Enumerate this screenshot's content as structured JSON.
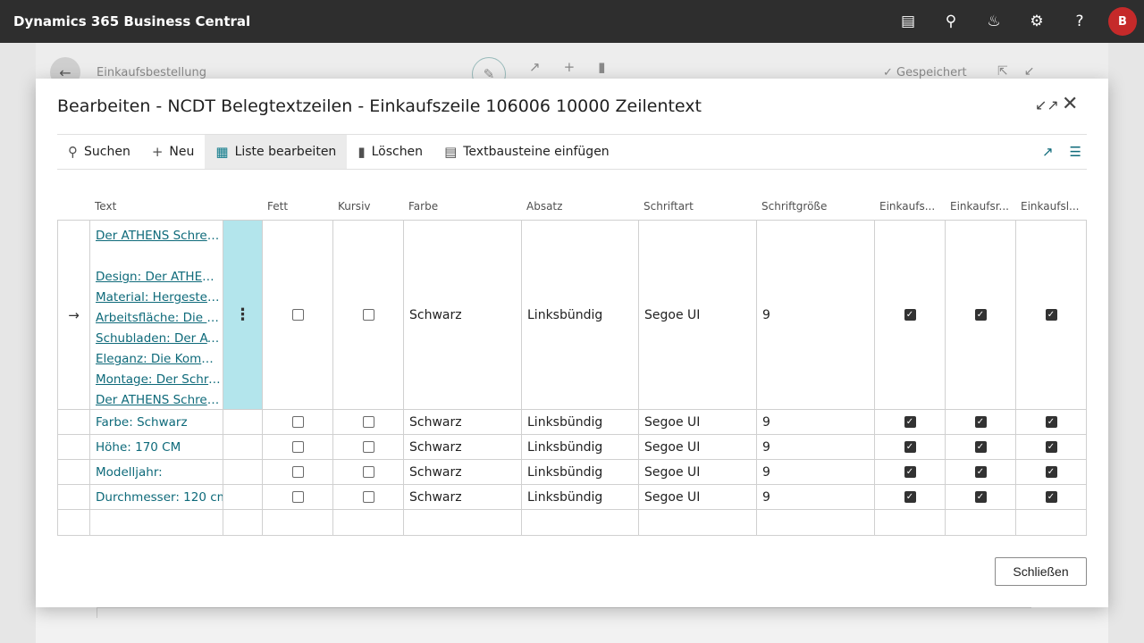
{
  "appbar": {
    "title": "Dynamics 365 Business Central",
    "avatar_initial": "B",
    "icons": [
      "document-icon",
      "search-icon",
      "bell-icon",
      "gear-icon",
      "help-icon"
    ]
  },
  "background_page": {
    "title": "Einkaufsbestellung",
    "saved_label": "Gespeichert"
  },
  "dialog": {
    "title": "Bearbeiten - NCDT Belegtextzeilen - Einkaufszeile 106006 10000 Zeilentext",
    "actions": {
      "search": "Suchen",
      "new": "Neu",
      "edit_list": "Liste bearbeiten",
      "delete": "Löschen",
      "insert_text_blocks": "Textbausteine einfügen"
    },
    "columns": {
      "text": "Text",
      "bold": "Fett",
      "italic": "Kursiv",
      "color": "Farbe",
      "paragraph": "Absatz",
      "font": "Schriftart",
      "font_size": "Schriftgröße",
      "purchase1": "Einkaufs...",
      "purchase2": "Einkaufsr...",
      "purchase3": "Einkaufsl..."
    },
    "rows": [
      {
        "lines": [
          "Der ATHENS Schreib...",
          "",
          "Design: Der ATHENS ...",
          "Material: Hergestellt ...",
          "Arbeitsfläche: Die gr...",
          "Schubladen: Der ATH...",
          "Eleganz: Die Kombin...",
          "Montage: Der Schrei...",
          "Der ATHENS Schreib..."
        ],
        "color": "Schwarz",
        "paragraph": "Linksbündig",
        "font": "Segoe UI",
        "font_size": "9"
      },
      {
        "text": "Farbe: Schwarz",
        "color": "Schwarz",
        "paragraph": "Linksbündig",
        "font": "Segoe UI",
        "font_size": "9"
      },
      {
        "text": "Höhe: 170 CM",
        "color": "Schwarz",
        "paragraph": "Linksbündig",
        "font": "Segoe UI",
        "font_size": "9"
      },
      {
        "text": "Modelljahr:",
        "color": "Schwarz",
        "paragraph": "Linksbündig",
        "font": "Segoe UI",
        "font_size": "9"
      },
      {
        "text": "Durchmesser: 120 cm",
        "color": "Schwarz",
        "paragraph": "Linksbündig",
        "font": "Segoe UI",
        "font_size": "9"
      }
    ],
    "close_label": "Schließen"
  }
}
